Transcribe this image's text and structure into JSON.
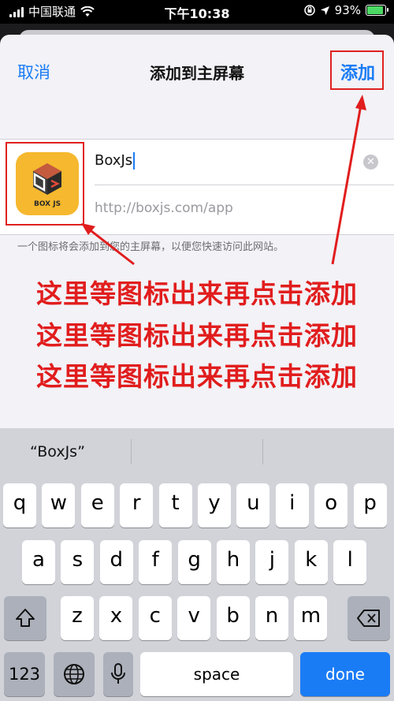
{
  "status_bar": {
    "carrier": "中国联通",
    "time": "下午10:38",
    "battery": "93%",
    "battery_level": 0.93
  },
  "nav": {
    "cancel_label": "取消",
    "title": "添加到主屏幕",
    "add_label": "添加"
  },
  "form": {
    "app_name": "BoxJs",
    "url": "http://boxjs.com/app",
    "hint": "一个图标将会添加到您的主屏幕，以便您快速访问此网站。"
  },
  "annotation": {
    "line": "这里等图标出来再点击添加"
  },
  "keyboard": {
    "suggestion": "“BoxJs”",
    "row1": [
      "q",
      "w",
      "e",
      "r",
      "t",
      "y",
      "u",
      "i",
      "o",
      "p"
    ],
    "row2": [
      "a",
      "s",
      "d",
      "f",
      "g",
      "h",
      "j",
      "k",
      "l"
    ],
    "row3": [
      "z",
      "x",
      "c",
      "v",
      "b",
      "n",
      "m"
    ],
    "numbers_label": "123",
    "space_label": "space",
    "done_label": "done"
  },
  "colors": {
    "accent": "#1a7cf5",
    "annotation": "#e11d1d",
    "icon_bg": "#f5b82e"
  },
  "icons": [
    "signal-icon",
    "wifi-icon",
    "orientation-lock-icon",
    "location-icon",
    "battery-icon",
    "clear-icon",
    "app-icon",
    "arrow-icon",
    "shift-icon",
    "backspace-icon",
    "globe-icon",
    "microphone-icon"
  ]
}
